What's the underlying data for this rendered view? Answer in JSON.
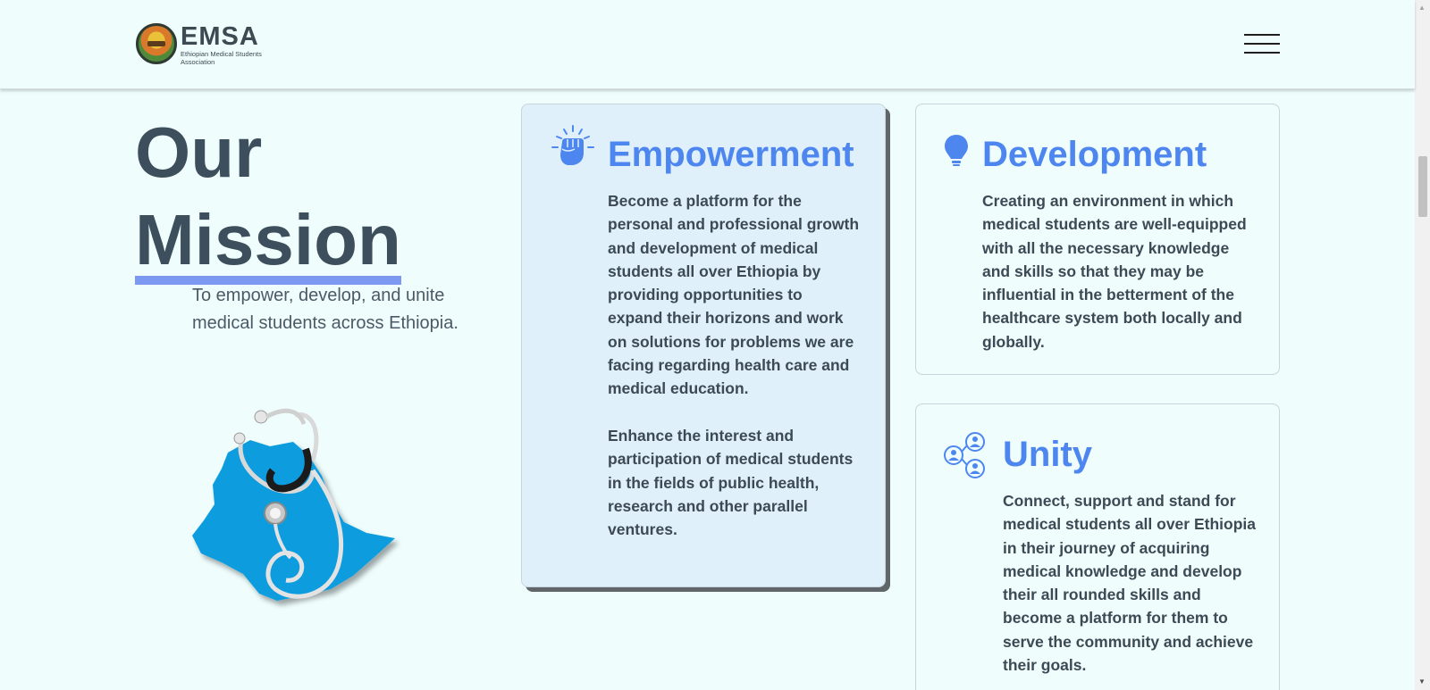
{
  "header": {
    "logo_title": "EMSA",
    "logo_subtitle": "Ethiopian Medical Students Association",
    "menu_icon": "hamburger-menu-icon"
  },
  "mission": {
    "title_line1": "Our",
    "title_line2": "Mission",
    "description": "To empower, develop, and unite medical students across Ethiopia."
  },
  "cards": {
    "empowerment": {
      "icon": "raised-fist-icon",
      "title": "Empowerment",
      "paragraph1": "Become a platform for the personal and professional growth and development of medical students all over Ethiopia by providing opportunities to expand their horizons and work on solutions for problems we are facing regarding health care and medical education.",
      "paragraph2": "Enhance the interest and participation of medical students in the fields of public health, research and other parallel ventures."
    },
    "development": {
      "icon": "lightbulb-icon",
      "title": "Development",
      "paragraph1": "Creating an environment in which medical students are well-equipped with all the necessary knowledge and skills so that they may be influential in the betterment of the healthcare system both locally and globally."
    },
    "unity": {
      "icon": "network-people-icon",
      "title": "Unity",
      "paragraph1": "Connect, support and stand for medical students all over Ethiopia in their journey of acquiring medical knowledge and develop their all rounded skills and become a platform for them to serve the community and achieve their goals."
    }
  },
  "colors": {
    "page_background": "#effdfd",
    "accent_blue": "#4e86f0",
    "heading_dark": "#3d4f5c",
    "map_blue": "#0c9ddf",
    "active_card_bg": "#dff0fb"
  }
}
